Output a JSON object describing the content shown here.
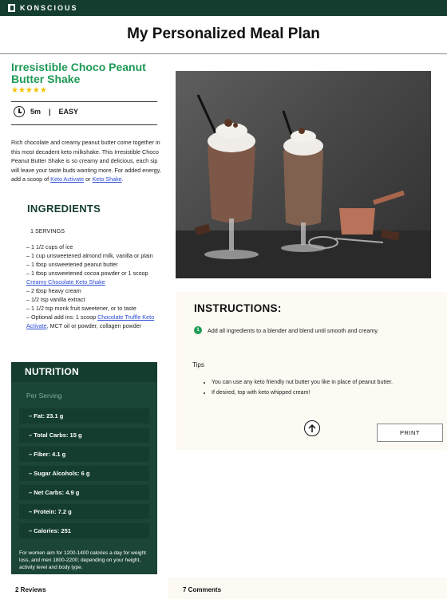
{
  "brand": {
    "name": "KONSCIOUS"
  },
  "page": {
    "title": "My Personalized Meal Plan"
  },
  "recipe": {
    "name": "Irresistible Choco Peanut Butter Shake",
    "rating": "★★★★★",
    "rating_value": 5,
    "time": "5m",
    "separator": "|",
    "difficulty": "EASY",
    "description": "Rich chocolate and creamy peanut butter come together in this most decadent keto milkshake. This Irresistible Choco Peanut Butter Shake is so creamy and delicious, each sip will leave your taste buds wanting more. For added energy, add a scoop of ",
    "desc_link1": "Keto Activate",
    "desc_or": " or ",
    "desc_link2": "Keto Shake",
    "desc_end": "."
  },
  "ingredients": {
    "title": "INGREDIENTS",
    "servings": "1 SERVINGS",
    "items": [
      "– 1 1/2 cups of ice",
      "– 1 cup unsweetened almond milk, vanilla or plain",
      "– 1 tbsp unsweetened peanut butter",
      "– 1 tbsp unsweetened cocoa powder or 1 scoop"
    ],
    "item4_link": "Creamy Chocolate Keto Shake",
    "items_b": [
      "– 2 tbsp heavy cream",
      "– 1/2 tsp vanilla extract",
      "– 1 1/2 tsp monk fruit sweetener, or to taste",
      "– Optional add ins: 1 scoop "
    ],
    "addin_link": "Chocolate Truffle Keto Activate",
    "addin_rest": ", MCT oil or powder, collagen powder"
  },
  "nutrition": {
    "title": "NUTRITION",
    "per_serving": "Per Serving",
    "rows": [
      "– Fat: 23.1 g",
      "– Total Carbs: 15 g",
      "– Fiber: 4.1 g",
      "– Sugar Alcohols: 6 g",
      "– Net Carbs: 4.9 g",
      "– Protein: 7.2 g",
      "– Calories: 251"
    ],
    "note": "For women aim for 1200-1400 calories a day for weight loss, and men 1800-2200; depending on your height, activity level and body type."
  },
  "instructions": {
    "title": "INSTRUCTIONS:",
    "steps": [
      {
        "num": "1",
        "text": "Add all ingredients to a blender and blend until smooth and creamy."
      }
    ],
    "tips_title": "Tips",
    "tips": [
      "You can use any keto friendly nut butter you like in place of peanut butter.",
      "If desired, top with keto whipped cream!"
    ],
    "print_label": "PRINT"
  },
  "footer": {
    "reviews": "2 Reviews",
    "comments": "7 Comments"
  },
  "colors": {
    "brand_dark_green": "#143d30",
    "accent_green": "#1e9a55",
    "link_blue": "#2b4bd6",
    "star_yellow": "#f2c200"
  },
  "icons": {
    "clock": "clock-icon",
    "arrow_up": "arrow-up-icon",
    "logo": "konscious-logo-icon"
  }
}
